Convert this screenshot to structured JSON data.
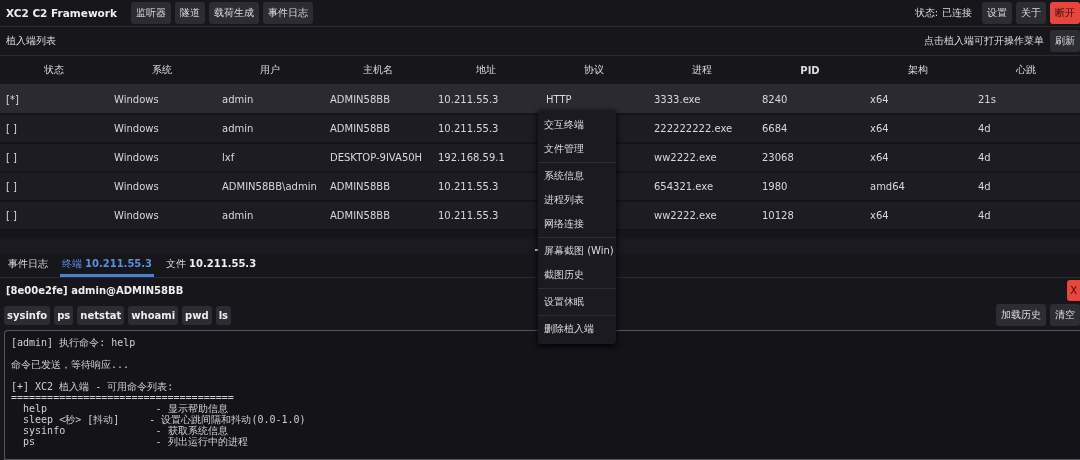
{
  "app_title": "XC2 C2 Framework",
  "nav_buttons": [
    "监听器",
    "隧道",
    "载荷生成",
    "事件日志"
  ],
  "status": {
    "label": "状态:",
    "value": "已连接"
  },
  "top_buttons": [
    {
      "label": "设置",
      "kind": "normal"
    },
    {
      "label": "关于",
      "kind": "normal"
    },
    {
      "label": "断开",
      "kind": "danger"
    }
  ],
  "section_title": "植入端列表",
  "hint": "点击植入端可打开操作菜单",
  "refresh_button": "刷新",
  "table": {
    "columns": [
      "状态",
      "系统",
      "用户",
      "主机名",
      "地址",
      "协议",
      "进程",
      "PID",
      "架构",
      "心跳"
    ],
    "rows": [
      {
        "selected": true,
        "cells": [
          "[*]",
          "Windows",
          "admin",
          "ADMIN58BB",
          "10.211.55.3",
          "HTTP",
          "3333.exe",
          "8240",
          "x64",
          "21s"
        ]
      },
      {
        "selected": false,
        "cells": [
          "[ ]",
          "Windows",
          "admin",
          "ADMIN58BB",
          "10.211.55.3",
          null,
          "222222222.exe",
          "6684",
          "x64",
          "4d"
        ]
      },
      {
        "selected": false,
        "cells": [
          "[ ]",
          "Windows",
          "lxf",
          "DESKTOP-9IVA50H",
          "192.168.59.1",
          null,
          "ww2222.exe",
          "23068",
          "x64",
          "4d"
        ]
      },
      {
        "selected": false,
        "cells": [
          "[ ]",
          "Windows",
          "ADMIN58BB\\admin",
          "ADMIN58BB",
          "10.211.55.3",
          null,
          "654321.exe",
          "1980",
          "amd64",
          "4d"
        ]
      },
      {
        "selected": false,
        "cells": [
          "[ ]",
          "Windows",
          "admin",
          "ADMIN58BB",
          "10.211.55.3",
          null,
          "ww2222.exe",
          "10128",
          "x64",
          "4d"
        ]
      }
    ]
  },
  "context_menu": [
    [
      "交互终端",
      "文件管理"
    ],
    [
      "系统信息",
      "进程列表",
      "网络连接"
    ],
    [
      "屏幕截图 (Win)",
      "截图历史"
    ],
    [
      "设置休眠"
    ],
    [
      "删除植入端"
    ]
  ],
  "bottom_tabs": [
    {
      "label": "事件日志",
      "selected": false
    },
    {
      "label": "终端",
      "target": "10.211.55.3",
      "selected": true
    },
    {
      "label": "文件",
      "target": "10.211.55.3",
      "selected": false
    }
  ],
  "session": "[8e00e2fe] admin@ADMIN58BB",
  "close_button": "X",
  "commands": [
    "sysinfo",
    "ps",
    "netstat",
    "whoami",
    "pwd",
    "ls"
  ],
  "history_buttons": [
    "加载历史",
    "清空"
  ],
  "terminal_blocks": [
    [
      "[admin] 执行命令: help"
    ],
    [
      "命令已发送，等待响应..."
    ],
    [
      "[+] XC2 植入端 - 可用命令列表:",
      "=====================================",
      "  help                  - 显示帮助信息",
      "  sleep <秒> [抖动]     - 设置心跳间隔和抖动(0.0-1.0)",
      "  sysinfo               - 获取系统信息",
      "  ps                    - 列出运行中的进程"
    ]
  ]
}
